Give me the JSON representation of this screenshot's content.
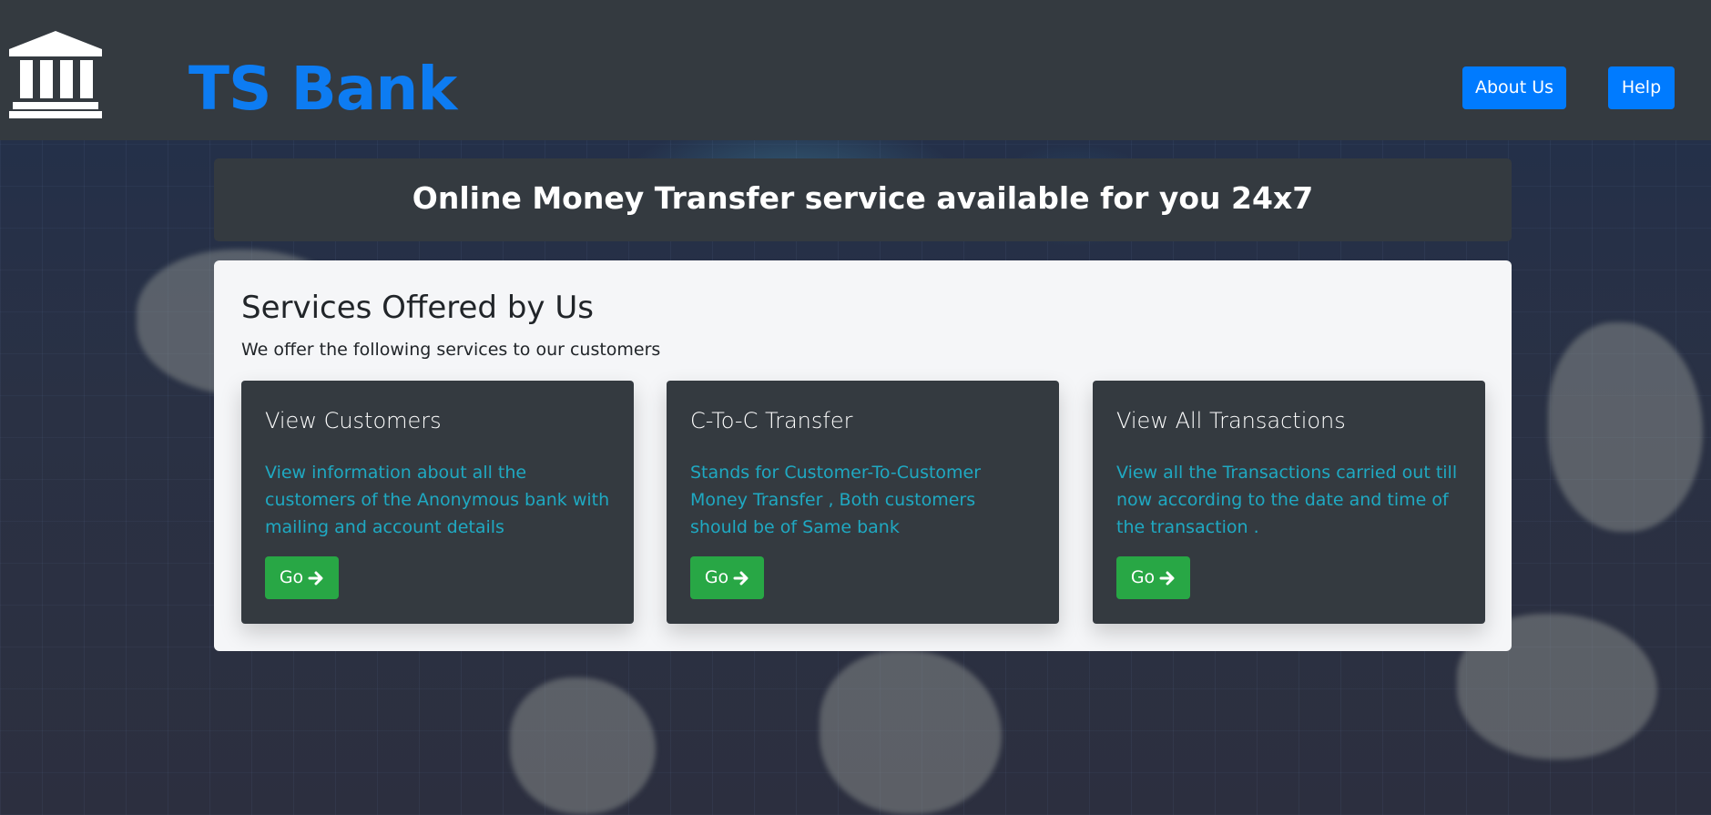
{
  "header": {
    "brand": "TS Bank",
    "logo_icon": "bank-building-icon",
    "nav": [
      {
        "label": "About Us"
      },
      {
        "label": "Help"
      }
    ]
  },
  "banner": {
    "text": "Online Money Transfer service available for you 24x7"
  },
  "services": {
    "title": "Services Offered by Us",
    "subtitle": "We offer the following services to our customers",
    "cards": [
      {
        "title": "View Customers",
        "text": "View information about all the customers of the Anonymous bank with mailing and account details",
        "button": "Go",
        "button_icon": "arrow-right-icon"
      },
      {
        "title": "C-To-C Transfer",
        "text": "Stands for Customer-To-Customer Money Transfer , Both customers should be of Same bank",
        "button": "Go",
        "button_icon": "arrow-right-icon"
      },
      {
        "title": "View All Transactions",
        "text": "View all the Transactions carried out till now according to the date and time of the transaction .",
        "button": "Go",
        "button_icon": "arrow-right-icon"
      }
    ]
  },
  "colors": {
    "navbar": "#343a40",
    "brand": "#0d7cf2",
    "primary_button": "#007bff",
    "go_button": "#28a745",
    "card_text": "#1fa9c2"
  }
}
